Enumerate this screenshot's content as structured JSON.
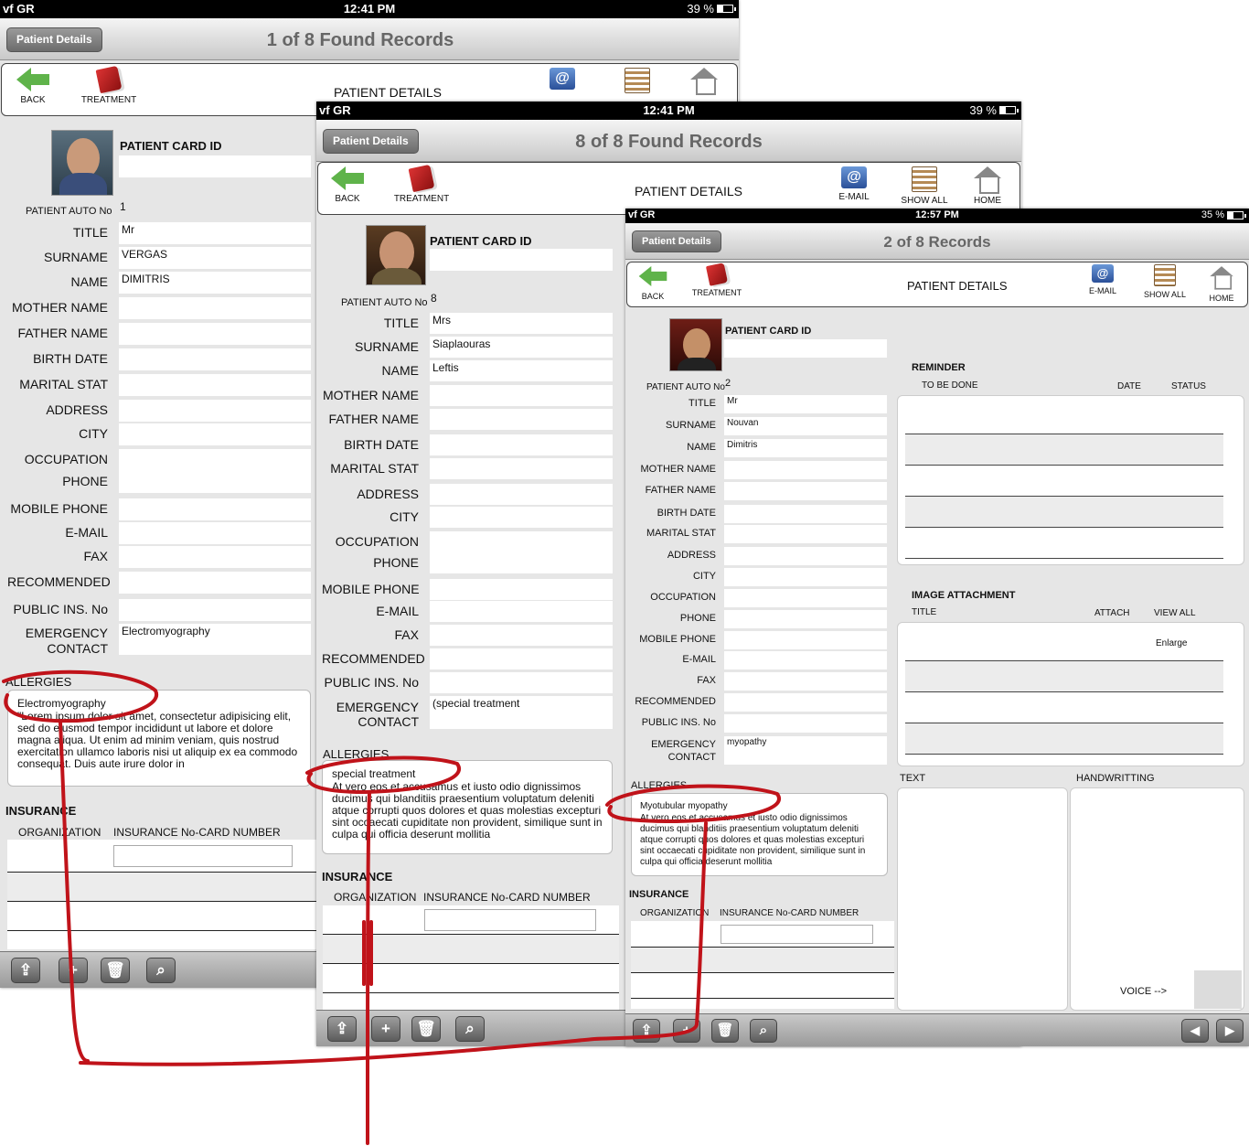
{
  "screens": [
    {
      "status": {
        "carrier": "vf GR",
        "time": "12:41 PM",
        "battery": "39 %"
      },
      "nav": {
        "button": "Patient Details",
        "title": "1 of 8 Found Records"
      },
      "toolbar": {
        "back": "BACK",
        "treatment": "TREATMENT",
        "heading": "PATIENT DETAILS"
      },
      "card_id_label": "PATIENT CARD ID",
      "auto_no_label": "PATIENT AUTO No",
      "auto_no": "1",
      "fields": [
        {
          "label": "TITLE",
          "value": "Mr"
        },
        {
          "label": "SURNAME",
          "value": "VERGAS"
        },
        {
          "label": "NAME",
          "value": "DIMITRIS"
        },
        {
          "label": "MOTHER  NAME",
          "value": ""
        },
        {
          "label": "FATHER NAME",
          "value": ""
        },
        {
          "label": "BIRTH DATE",
          "value": ""
        },
        {
          "label": "MARITAL STAT",
          "value": ""
        },
        {
          "label": "ADDRESS",
          "value": ""
        },
        {
          "label": "CITY",
          "value": ""
        },
        {
          "label": "OCCUPATION",
          "value": ""
        },
        {
          "label": "PHONE",
          "value": ""
        },
        {
          "label": "MOBILE PHONE",
          "value": ""
        },
        {
          "label": "E-MAIL",
          "value": ""
        },
        {
          "label": "FAX",
          "value": ""
        },
        {
          "label": "RECOMMENDED",
          "value": ""
        },
        {
          "label": "PUBLIC INS. No",
          "value": ""
        }
      ],
      "emergency": {
        "label1": "EMERGENCY",
        "label2": "CONTACT",
        "value": "Electromyography"
      },
      "allergies": {
        "label": "ALLERGIES",
        "first": "Electromyography",
        "body": "\"Lorem ipsum dolor sit amet, consectetur adipisicing elit, sed do eiusmod tempor incididunt ut labore et dolore magna aliqua. Ut enim ad minim veniam, quis nostrud exercitation ullamco laboris nisi ut aliquip ex ea commodo consequat. Duis aute irure dolor in"
      },
      "insurance": {
        "title": "INSURANCE",
        "col1": "ORGANIZATION",
        "col2": "INSURANCE No-CARD NUMBER"
      },
      "bottom": {
        "share": "⇪",
        "add": "+",
        "trash": "🗑",
        "search": "⌕"
      }
    },
    {
      "status": {
        "carrier": "vf GR",
        "time": "12:41 PM",
        "battery": "39 %"
      },
      "nav": {
        "button": "Patient Details",
        "title": "8 of 8 Found Records"
      },
      "toolbar": {
        "back": "BACK",
        "treatment": "TREATMENT",
        "heading": "PATIENT DETAILS",
        "email": "E-MAIL",
        "show_all": "SHOW ALL",
        "home": "HOME"
      },
      "card_id_label": "PATIENT CARD ID",
      "auto_no_label": "PATIENT AUTO No",
      "auto_no": "8",
      "fields": [
        {
          "label": "TITLE",
          "value": "Mrs"
        },
        {
          "label": "SURNAME",
          "value": "Siaplaouras"
        },
        {
          "label": "NAME",
          "value": "Leftis"
        },
        {
          "label": "MOTHER  NAME",
          "value": ""
        },
        {
          "label": "FATHER NAME",
          "value": ""
        },
        {
          "label": "BIRTH DATE",
          "value": ""
        },
        {
          "label": "MARITAL STAT",
          "value": ""
        },
        {
          "label": "ADDRESS",
          "value": ""
        },
        {
          "label": "CITY",
          "value": ""
        },
        {
          "label": "OCCUPATION",
          "value": ""
        },
        {
          "label": "PHONE",
          "value": ""
        },
        {
          "label": "MOBILE PHONE",
          "value": ""
        },
        {
          "label": "E-MAIL",
          "value": ""
        },
        {
          "label": "FAX",
          "value": ""
        },
        {
          "label": "RECOMMENDED",
          "value": ""
        },
        {
          "label": "PUBLIC INS. No",
          "value": ""
        }
      ],
      "emergency": {
        "label1": "EMERGENCY",
        "label2": "CONTACT",
        "value": "(special treatment"
      },
      "allergies": {
        "label": "ALLERGIES",
        "first": "special treatment",
        "body": "At vero eos et accusamus et iusto odio dignissimos ducimus qui blanditiis praesentium voluptatum deleniti atque corrupti quos dolores et quas molestias excepturi sint occaecati cupiditate non provident, similique sunt in culpa qui officia deserunt mollitia"
      },
      "insurance": {
        "title": "INSURANCE",
        "col1": "ORGANIZATION",
        "col2": "INSURANCE No-CARD NUMBER"
      },
      "bottom": {
        "share": "⇪",
        "add": "+",
        "trash": "🗑",
        "search": "⌕"
      }
    },
    {
      "status": {
        "carrier": "vf GR",
        "time": "12:57 PM",
        "battery": "35 %"
      },
      "nav": {
        "button": "Patient Details",
        "title": "2 of 8 Records"
      },
      "toolbar": {
        "back": "BACK",
        "treatment": "TREATMENT",
        "heading": "PATIENT DETAILS",
        "email": "E-MAIL",
        "show_all": "SHOW ALL",
        "home": "HOME"
      },
      "card_id_label": "PATIENT CARD ID",
      "auto_no_label": "PATIENT AUTO No",
      "auto_no": "2",
      "fields": [
        {
          "label": "TITLE",
          "value": "Mr"
        },
        {
          "label": "SURNAME",
          "value": "Nouvan"
        },
        {
          "label": "NAME",
          "value": "Dimitris"
        },
        {
          "label": "MOTHER  NAME",
          "value": ""
        },
        {
          "label": "FATHER NAME",
          "value": ""
        },
        {
          "label": "BIRTH DATE",
          "value": ""
        },
        {
          "label": "MARITAL STAT",
          "value": ""
        },
        {
          "label": "ADDRESS",
          "value": ""
        },
        {
          "label": "CITY",
          "value": ""
        },
        {
          "label": "OCCUPATION",
          "value": ""
        },
        {
          "label": "PHONE",
          "value": ""
        },
        {
          "label": "MOBILE PHONE",
          "value": ""
        },
        {
          "label": "E-MAIL",
          "value": ""
        },
        {
          "label": "FAX",
          "value": ""
        },
        {
          "label": "RECOMMENDED",
          "value": ""
        },
        {
          "label": "PUBLIC INS. No",
          "value": ""
        }
      ],
      "emergency": {
        "label1": "EMERGENCY",
        "label2": "CONTACT",
        "value": "myopathy"
      },
      "allergies": {
        "label": "ALLERGIES",
        "first": "Myotubular myopathy",
        "body": "At vero eos et accusamus et iusto odio dignissimos ducimus qui blanditiis praesentium voluptatum deleniti atque corrupti quos dolores et quas molestias excepturi sint occaecati cupiditate non provident, similique sunt in culpa qui officia deserunt mollitia"
      },
      "insurance": {
        "title": "INSURANCE",
        "col1": "ORGANIZATION",
        "col2": "INSURANCE No-CARD NUMBER"
      },
      "reminder": {
        "title": "REMINDER",
        "col1": "TO BE DONE",
        "col2": "DATE",
        "col3": "STATUS"
      },
      "image_attachment": {
        "title": "IMAGE ATTACHMENT",
        "col1": "TITLE",
        "col2": "ATTACH",
        "col3": "VIEW ALL",
        "enlarge": "Enlarge"
      },
      "text_label": "TEXT",
      "handwriting_label": "HANDWRITTING",
      "voice": "VOICE -->",
      "bottom": {
        "share": "⇪",
        "add": "+",
        "trash": "🗑",
        "search": "⌕",
        "prev": "◀",
        "next": "▶"
      }
    }
  ],
  "colors": {
    "annotation": "#c0131a",
    "accent_green": "#5fb34a"
  }
}
